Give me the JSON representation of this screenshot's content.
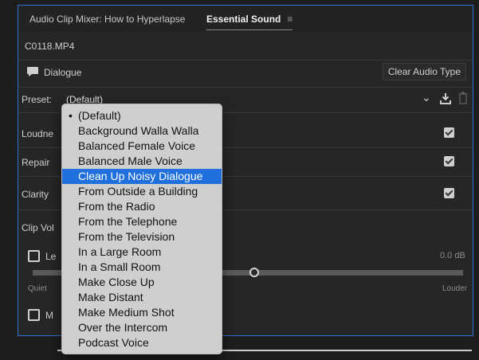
{
  "tabs": [
    {
      "label": "Audio Clip Mixer: How to Hyperlapse"
    },
    {
      "label": "Essential Sound",
      "menu_glyph": "≡"
    }
  ],
  "clip_name": "C0118.MP4",
  "audio_type": {
    "label": "Dialogue",
    "clear_button": "Clear Audio Type"
  },
  "preset": {
    "label": "Preset:",
    "value": "(Default)",
    "chevron": "⌄"
  },
  "sections": {
    "loudness_label": "Loudne",
    "repair_label": "Repair",
    "clarity_label": "Clarity",
    "clip_volume_label": "Clip Vol",
    "level_label": "Le",
    "level_value": "0.0 dB",
    "slider_quieter": "Quiet",
    "slider_louder": "Louder",
    "mute_label": "M"
  },
  "menu": {
    "items": [
      {
        "label": "(Default)",
        "checked": true
      },
      {
        "label": "Background Walla Walla"
      },
      {
        "label": "Balanced Female Voice"
      },
      {
        "label": "Balanced Male Voice"
      },
      {
        "label": "Clean Up Noisy Dialogue",
        "highlighted": true
      },
      {
        "label": "From Outside a Building"
      },
      {
        "label": "From the Radio"
      },
      {
        "label": "From the Telephone"
      },
      {
        "label": "From the Television"
      },
      {
        "label": "In a Large Room"
      },
      {
        "label": "In a Small Room"
      },
      {
        "label": "Make Close Up"
      },
      {
        "label": "Make Distant"
      },
      {
        "label": "Make Medium Shot"
      },
      {
        "label": "Over the Intercom"
      },
      {
        "label": "Podcast Voice"
      }
    ]
  },
  "colors": {
    "accent": "#1f6fdc",
    "panel_border": "#2f6fd1"
  }
}
